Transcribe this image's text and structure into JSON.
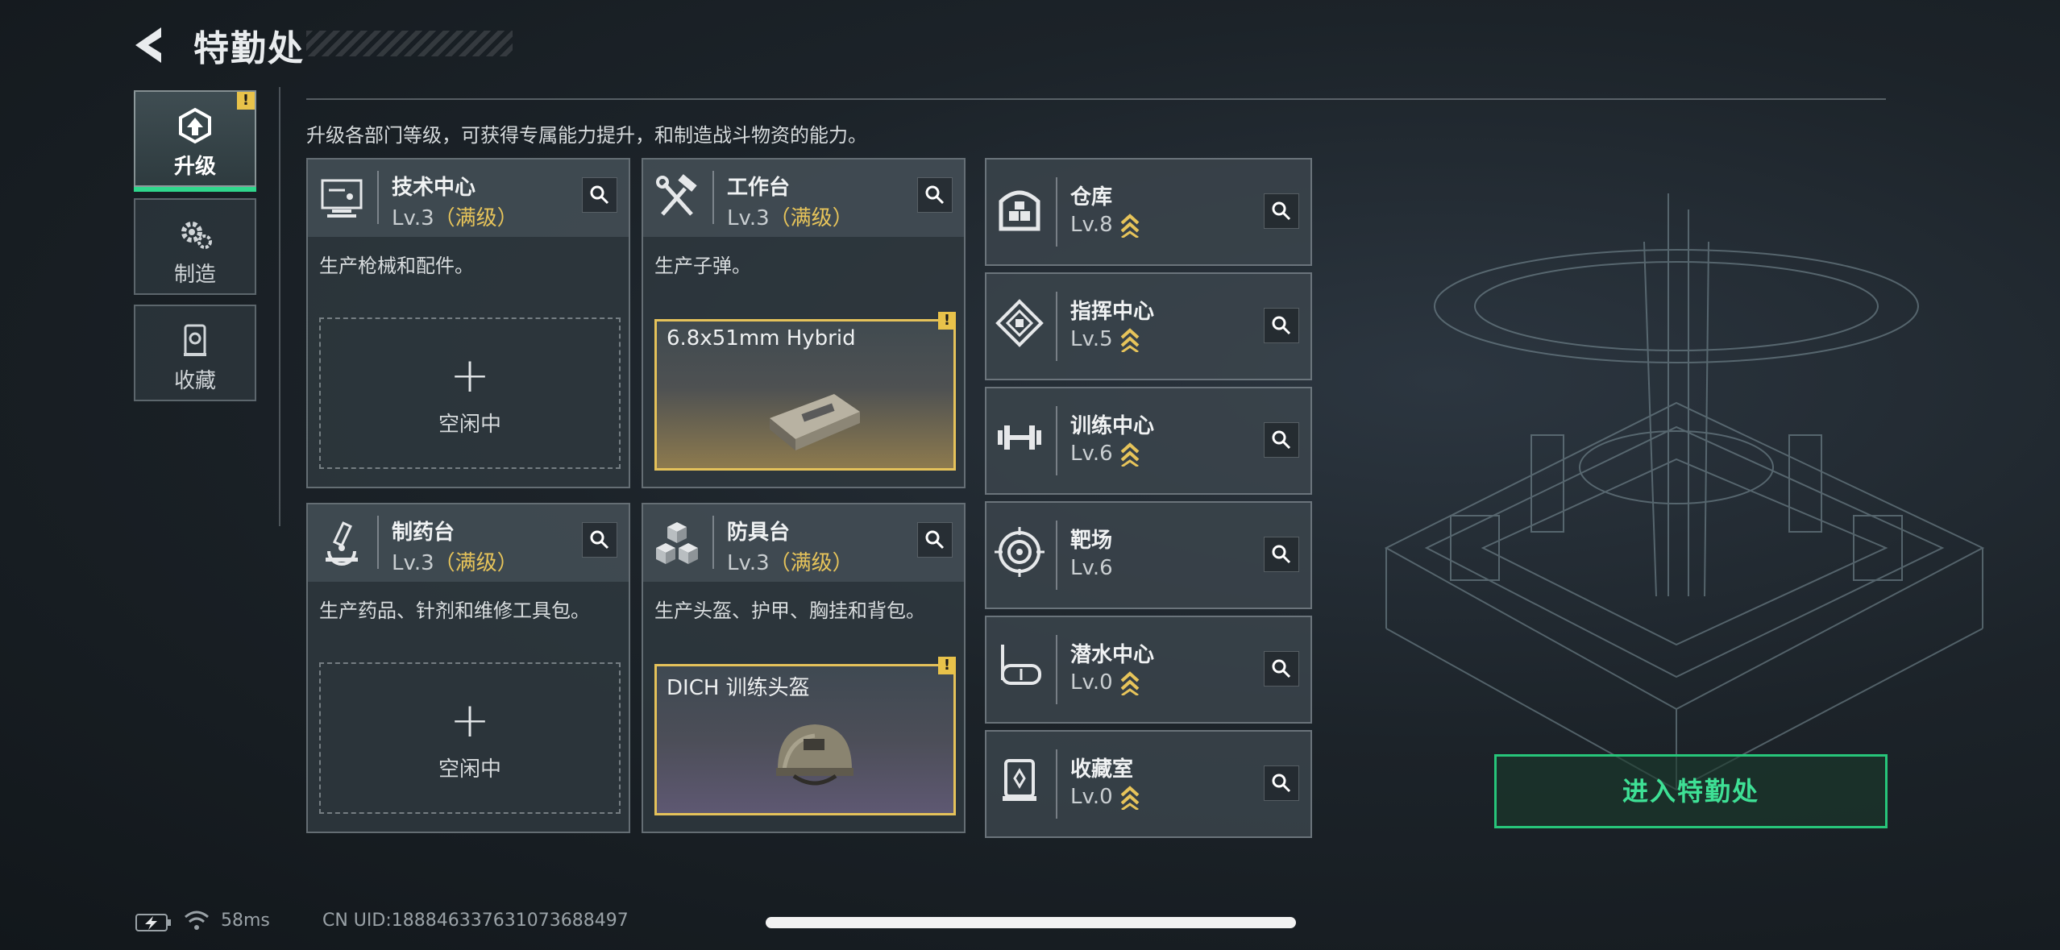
{
  "header": {
    "title": "特勤处"
  },
  "intro": "升级各部门等级，可获得专属能力提升，和制造战斗物资的能力。",
  "tabs": [
    {
      "label": "升级",
      "active": true,
      "badge": "!"
    },
    {
      "label": "制造",
      "active": false
    },
    {
      "label": "收藏",
      "active": false
    }
  ],
  "cards": [
    {
      "name": "技术中心",
      "level": "Lv.3",
      "maxed": "（满级）",
      "desc": "生产枪械和配件。",
      "slot": {
        "state": "empty",
        "plus": "+",
        "text": "空闲中"
      }
    },
    {
      "name": "工作台",
      "level": "Lv.3",
      "maxed": "（满级）",
      "desc": "生产子弹。",
      "slot": {
        "state": "item",
        "item_name": "6.8x51mm Hybrid",
        "badge": "!"
      }
    },
    {
      "name": "制药台",
      "level": "Lv.3",
      "maxed": "（满级）",
      "desc": "生产药品、针剂和维修工具包。",
      "slot": {
        "state": "empty",
        "plus": "+",
        "text": "空闲中"
      }
    },
    {
      "name": "防具台",
      "level": "Lv.3",
      "maxed": "（满级）",
      "desc": "生产头盔、护甲、胸挂和背包。",
      "slot": {
        "state": "item",
        "item_name": "DICH 训练头盔",
        "badge": "!"
      }
    }
  ],
  "small_cards": [
    {
      "name": "仓库",
      "level": "Lv.8",
      "upgradable": true,
      "icon": "warehouse-icon"
    },
    {
      "name": "指挥中心",
      "level": "Lv.5",
      "upgradable": true,
      "icon": "command-center-icon"
    },
    {
      "name": "训练中心",
      "level": "Lv.6",
      "upgradable": true,
      "icon": "dumbbell-icon"
    },
    {
      "name": "靶场",
      "level": "Lv.6",
      "upgradable": false,
      "icon": "target-icon"
    },
    {
      "name": "潜水中心",
      "level": "Lv.0",
      "upgradable": true,
      "icon": "diving-mask-icon"
    },
    {
      "name": "收藏室",
      "level": "Lv.0",
      "upgradable": true,
      "icon": "collection-room-icon"
    }
  ],
  "enter_button": "进入特勤处",
  "status": {
    "ping": "58ms",
    "uid": "CN UID:188846337631073688497"
  },
  "colors": {
    "accent": "#2fd78c",
    "maxed": "#e7c45a",
    "alert": "#e8c24a"
  }
}
